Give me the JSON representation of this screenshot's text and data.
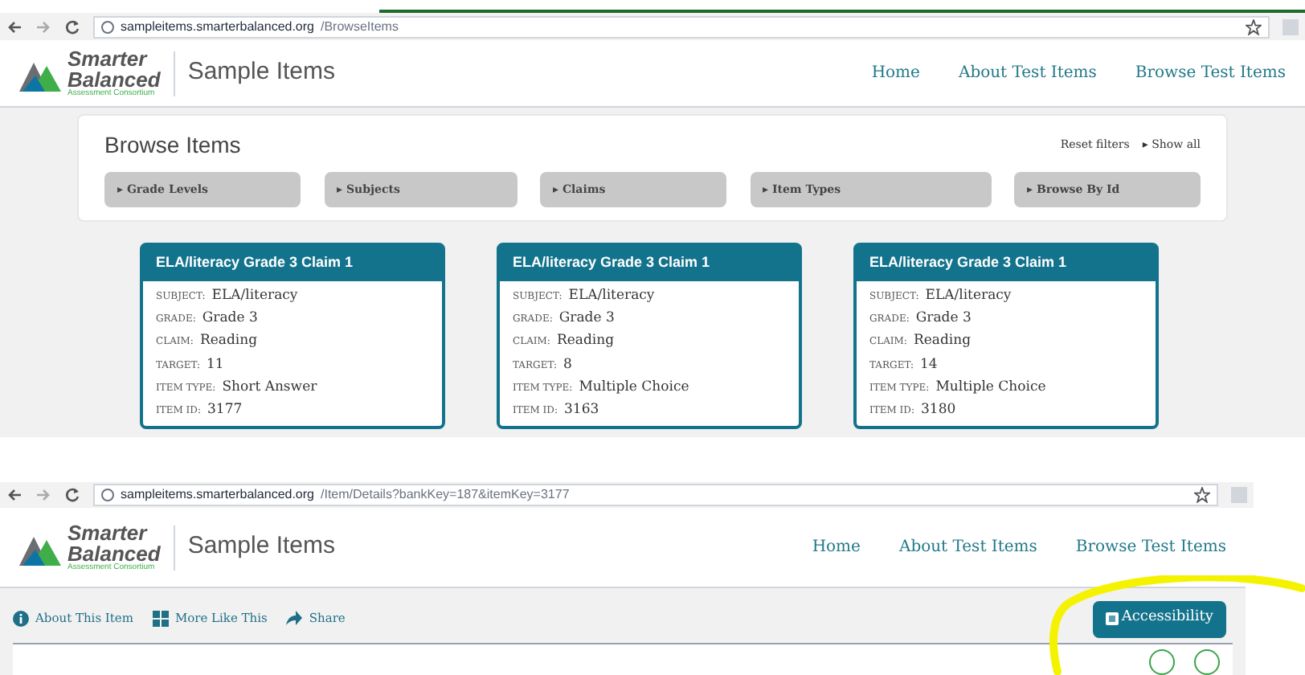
{
  "first_screenshot": {
    "address_bar": {
      "host": "sampleitems.smarterbalanced.org",
      "path": "/BrowseItems"
    },
    "header": {
      "logo": {
        "line_1": "Smarter",
        "line_2": "Balanced",
        "tagline": "Assessment Consortium"
      },
      "site_title": "Sample Items",
      "nav": [
        "Home",
        "About Test Items",
        "Browse Test Items"
      ]
    },
    "browse": {
      "title": "Browse Items",
      "links": [
        "Reset filters",
        "▸ Show all"
      ],
      "filters": [
        "▸ Grade Levels",
        "▸ Subjects",
        "▸ Claims",
        "▸ Item Types",
        "▸ Browse By Id"
      ]
    },
    "cards": [
      {
        "title": "ELA/literacy Grade 3 Claim 1",
        "fields": [
          {
            "label": "SUBJECT:",
            "value": "ELA/literacy"
          },
          {
            "label": "GRADE:",
            "value": "Grade 3"
          },
          {
            "label": "CLAIM:",
            "value": "Reading"
          },
          {
            "label": "TARGET:",
            "value": "11"
          },
          {
            "label": "ITEM TYPE:",
            "value": "Short Answer"
          },
          {
            "label": "ITEM ID:",
            "value": "3177"
          }
        ]
      },
      {
        "title": "ELA/literacy Grade 3 Claim 1",
        "fields": [
          {
            "label": "SUBJECT:",
            "value": "ELA/literacy"
          },
          {
            "label": "GRADE:",
            "value": "Grade 3"
          },
          {
            "label": "CLAIM:",
            "value": "Reading"
          },
          {
            "label": "TARGET:",
            "value": "8"
          },
          {
            "label": "ITEM TYPE:",
            "value": "Multiple Choice"
          },
          {
            "label": "ITEM ID:",
            "value": "3163"
          }
        ]
      },
      {
        "title": "ELA/literacy Grade 3 Claim 1",
        "fields": [
          {
            "label": "SUBJECT:",
            "value": "ELA/literacy"
          },
          {
            "label": "GRADE:",
            "value": "Grade 3"
          },
          {
            "label": "CLAIM:",
            "value": "Reading"
          },
          {
            "label": "TARGET:",
            "value": "14"
          },
          {
            "label": "ITEM TYPE:",
            "value": "Multiple Choice"
          },
          {
            "label": "ITEM ID:",
            "value": "3180"
          }
        ]
      }
    ]
  },
  "second_screenshot": {
    "address_bar": {
      "host": "sampleitems.smarterbalanced.org",
      "path": "/Item/Details?bankKey=187&itemKey=3177"
    },
    "header": {
      "logo": {
        "line_1": "Smarter",
        "line_2": "Balanced",
        "tagline": "Assessment Consortium"
      },
      "site_title": "Sample Items",
      "nav": [
        "Home",
        "About Test Items",
        "Browse Test Items"
      ]
    },
    "toolbar": [
      {
        "kind": "info",
        "label": "About This Item"
      },
      {
        "kind": "grid",
        "label": "More Like This"
      },
      {
        "kind": "share",
        "label": "Share"
      }
    ],
    "accessibility_button": "Accessibility"
  }
}
